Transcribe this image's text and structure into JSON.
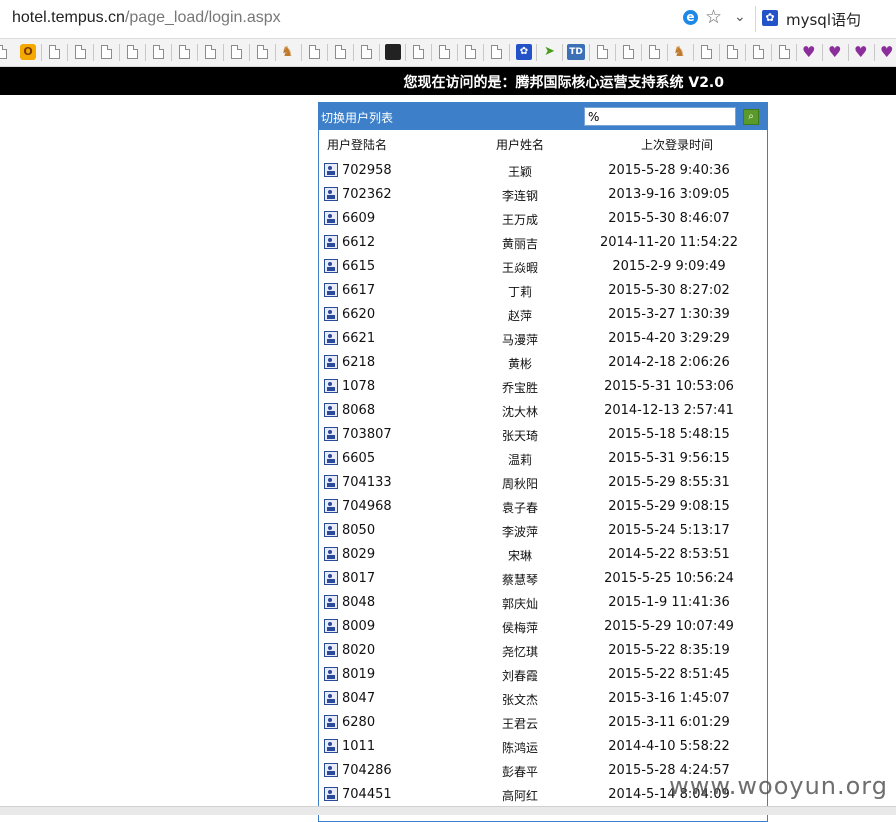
{
  "browser": {
    "url_host": "hotel.tempus.cn",
    "url_path": "/page_load/login.aspx",
    "search_engine_text": "mysql语句",
    "icons": [
      "ie-icon",
      "star-icon",
      "chevron-down-icon",
      "paw-icon"
    ]
  },
  "page": {
    "system_title": "您现在访问的是：腾邦国际核心运营支持系统  V2.0",
    "panel_label": "切换用户列表",
    "filter_value": "%",
    "columns": {
      "login": "用户登陆名",
      "name": "用户姓名",
      "last_login": "上次登录时间"
    },
    "users": [
      {
        "login": "702958",
        "name": "王颖",
        "time": "2015-5-28 9:40:36"
      },
      {
        "login": "702362",
        "name": "李连钢",
        "time": "2013-9-16 3:09:05"
      },
      {
        "login": "6609",
        "name": "王万成",
        "time": "2015-5-30 8:46:07"
      },
      {
        "login": "6612",
        "name": "黄丽吉",
        "time": "2014-11-20 11:54:22"
      },
      {
        "login": "6615",
        "name": "王焱暇",
        "time": "2015-2-9 9:09:49"
      },
      {
        "login": "6617",
        "name": "丁莉",
        "time": "2015-5-30 8:27:02"
      },
      {
        "login": "6620",
        "name": "赵萍",
        "time": "2015-3-27 1:30:39"
      },
      {
        "login": "6621",
        "name": "马漫萍",
        "time": "2015-4-20 3:29:29"
      },
      {
        "login": "6218",
        "name": "黄彬",
        "time": "2014-2-18 2:06:26"
      },
      {
        "login": "1078",
        "name": "乔宝胜",
        "time": "2015-5-31 10:53:06"
      },
      {
        "login": "8068",
        "name": "沈大林",
        "time": "2014-12-13 2:57:41"
      },
      {
        "login": "703807",
        "name": "张天琦",
        "time": "2015-5-18 5:48:15"
      },
      {
        "login": "6605",
        "name": "温莉",
        "time": "2015-5-31 9:56:15"
      },
      {
        "login": "704133",
        "name": "周秋阳",
        "time": "2015-5-29 8:55:31"
      },
      {
        "login": "704968",
        "name": "袁子春",
        "time": "2015-5-29 9:08:15"
      },
      {
        "login": "8050",
        "name": "李波萍",
        "time": "2015-5-24 5:13:17"
      },
      {
        "login": "8029",
        "name": "宋琳",
        "time": "2014-5-22 8:53:51"
      },
      {
        "login": "8017",
        "name": "蔡慧琴",
        "time": "2015-5-25 10:56:24"
      },
      {
        "login": "8048",
        "name": "郭庆灿",
        "time": "2015-1-9 11:41:36"
      },
      {
        "login": "8009",
        "name": "侯梅萍",
        "time": "2015-5-29 10:07:49"
      },
      {
        "login": "8020",
        "name": "尧忆琪",
        "time": "2015-5-22 8:35:19"
      },
      {
        "login": "8019",
        "name": "刘春霞",
        "time": "2015-5-22 8:51:45"
      },
      {
        "login": "8047",
        "name": "张文杰",
        "time": "2015-3-16 1:45:07"
      },
      {
        "login": "6280",
        "name": "王君云",
        "time": "2015-3-11 6:01:29"
      },
      {
        "login": "1011",
        "name": "陈鸿运",
        "time": "2014-4-10 5:58:22"
      },
      {
        "login": "704286",
        "name": "彭春平",
        "time": "2015-5-28 4:24:57"
      },
      {
        "login": "704451",
        "name": "高阿红",
        "time": "2014-5-14 8:04:09"
      }
    ]
  },
  "watermark": "www.wooyun.org",
  "colors": {
    "panel_header": "#3d80c9",
    "top_strip": "#000000",
    "search_button": "#5a9a2a"
  }
}
